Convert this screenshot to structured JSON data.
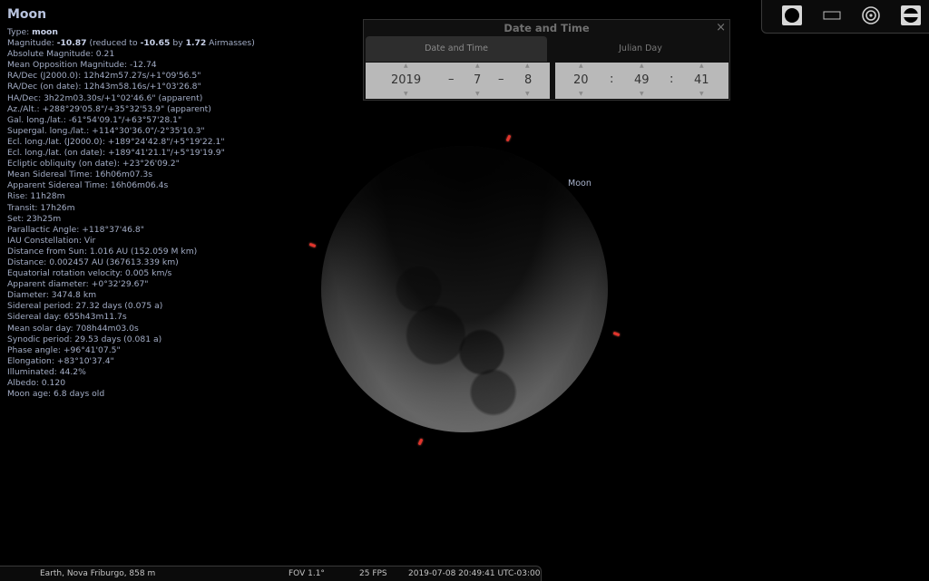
{
  "info": {
    "title": "Moon",
    "type_label": "Type: ",
    "type_value": "moon",
    "magnitude": {
      "label": "Magnitude: ",
      "value": "-10.87",
      "reduced_prefix": " (reduced to ",
      "reduced_value": "-10.65",
      "by": " by ",
      "airmasses": "1.72",
      "suffix": " Airmasses)"
    },
    "lines": [
      "Absolute Magnitude: 0.21",
      "Mean Opposition Magnitude: -12.74",
      "RA/Dec (J2000.0): 12h42m57.27s/+1°09'56.5\"",
      "RA/Dec (on date): 12h43m58.16s/+1°03'26.8\"",
      "HA/Dec: 3h22m03.30s/+1°02'46.6\" (apparent)",
      "Az./Alt.: +288°29'05.8\"/+35°32'53.9\" (apparent)",
      "Gal. long./lat.: -61°54'09.1\"/+63°57'28.1\"",
      "Supergal. long./lat.: +114°30'36.0\"/-2°35'10.3\"",
      "Ecl. long./lat. (J2000.0): +189°24'42.8\"/+5°19'22.1\"",
      "Ecl. long./lat. (on date): +189°41'21.1\"/+5°19'19.9\"",
      "Ecliptic obliquity (on date): +23°26'09.2\"",
      "Mean Sidereal Time: 16h06m07.3s",
      "Apparent Sidereal Time: 16h06m06.4s",
      "Rise: 11h28m",
      "Transit: 17h26m",
      "Set: 23h25m",
      "Parallactic Angle: +118°37'46.8\"",
      "IAU Constellation: Vir",
      "Distance from Sun: 1.016 AU (152.059 M km)",
      "Distance: 0.002457 AU (367613.339 km)",
      "Equatorial rotation velocity: 0.005 km/s",
      "Apparent diameter: +0°32'29.67\"",
      "Diameter: 3474.8 km",
      "Sidereal period: 27.32 days (0.075 a)",
      "Sidereal day: 655h43m11.7s",
      "Mean solar day: 708h44m03.0s",
      "Synodic period: 29.53 days (0.081 a)",
      "Phase angle: +96°41'07.5\"",
      "Elongation: +83°10'37.4\"",
      "Illuminated: 44.2%",
      "Albedo: 0.120",
      "Moon age: 6.8 days old"
    ]
  },
  "sky": {
    "object_label": "Moon"
  },
  "dialog": {
    "title": "Date and Time",
    "close_symbol": "×",
    "tabs": [
      "Date and Time",
      "Julian Day"
    ],
    "date": {
      "year": "2019",
      "month": "7",
      "day": "8",
      "separator": "–"
    },
    "time": {
      "hour": "20",
      "minute": "49",
      "second": "41",
      "separator": ":"
    },
    "spin_up": "▲",
    "spin_down": "▼"
  },
  "toolbar": {
    "icons": [
      "full-disk-icon",
      "rectangle-icon",
      "target-icon",
      "ocular-icon"
    ]
  },
  "status": {
    "location": "Earth, Nova Friburgo, 858 m",
    "fov": "FOV 1.1°",
    "fps": "25 FPS",
    "datetime": "2019-07-08 20:49:41 UTC-03:00"
  },
  "colors": {
    "background": "#000000",
    "info_text": "#a3adc6",
    "marker": "#e2342c"
  }
}
